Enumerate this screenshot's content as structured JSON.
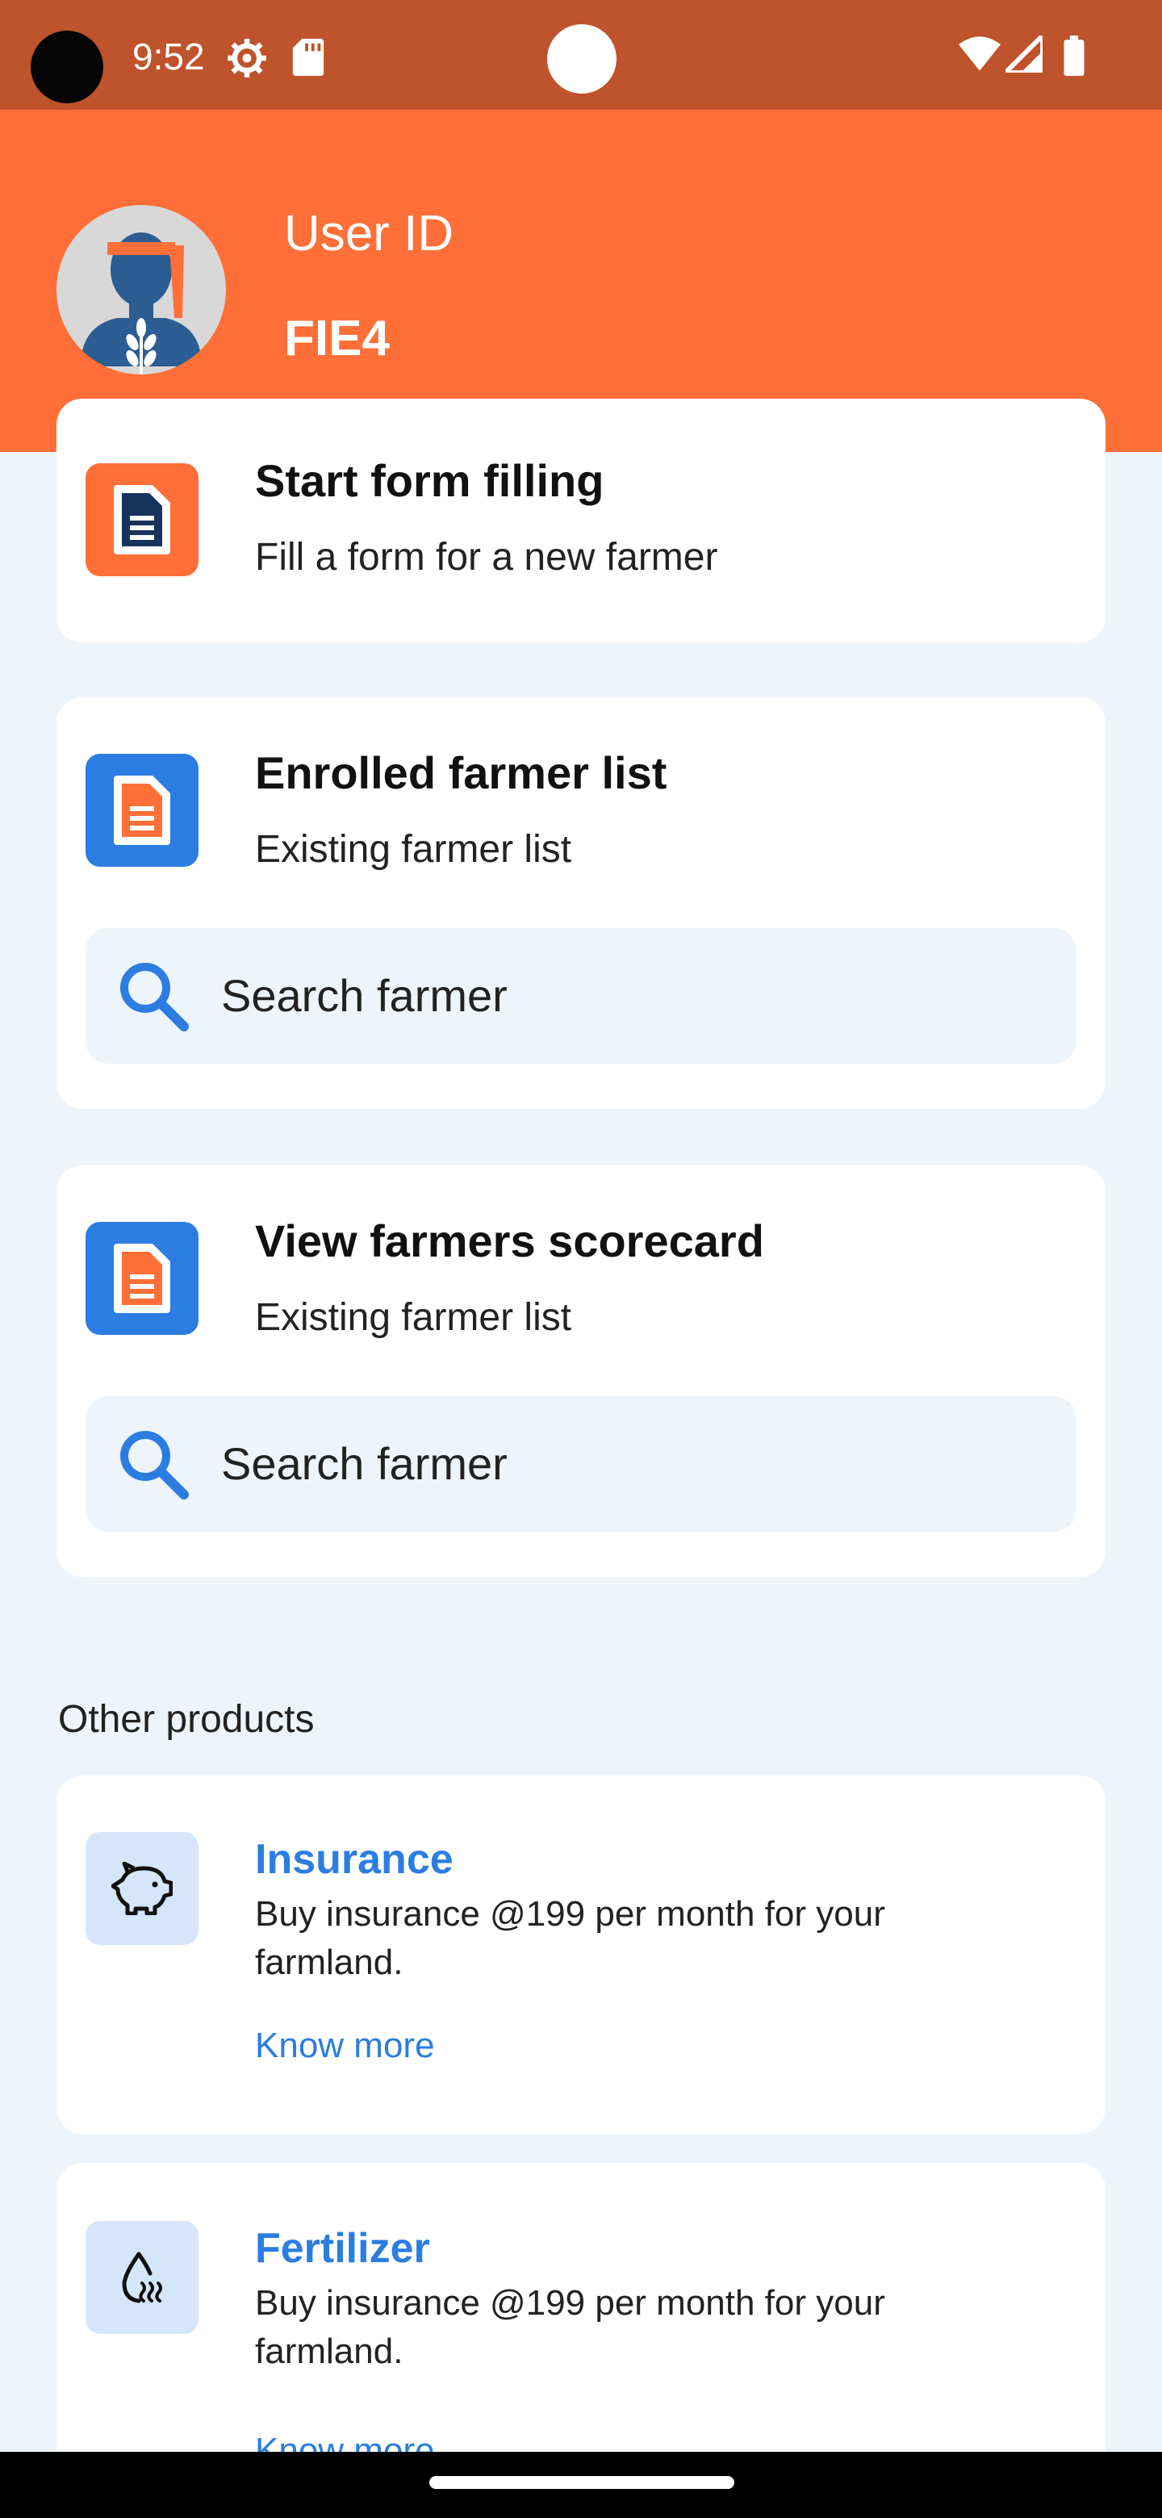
{
  "status_bar": {
    "time": "9:52",
    "icons": [
      "camera-cutout",
      "gear-icon",
      "sd-card-icon",
      "notification-dot",
      "wifi-icon",
      "cell-signal-icon",
      "battery-icon"
    ],
    "background": "#bf532b"
  },
  "header": {
    "user_id_label": "User ID",
    "user_id_value": "FIE4",
    "background": "#ff6f37",
    "avatar_icon": "farmer-avatar-icon"
  },
  "cards": {
    "start_form": {
      "title": "Start form filling",
      "subtitle": "Fill a form for a new farmer",
      "icon": "document-icon"
    },
    "enrolled_list": {
      "title": "Enrolled farmer list",
      "subtitle": "Existing farmer list",
      "icon": "document-icon",
      "search_placeholder": "Search farmer"
    },
    "scorecard": {
      "title": "View farmers scorecard",
      "subtitle": "Existing farmer list",
      "icon": "document-icon",
      "search_placeholder": "Search farmer"
    }
  },
  "other_products": {
    "label": "Other products",
    "items": [
      {
        "title": "Insurance",
        "description": "Buy insurance @199 per month for your farmland.",
        "link": "Know more",
        "icon": "piggy-bank-icon"
      },
      {
        "title": "Fertilizer",
        "description": "Buy insurance @199 per month for your farmland.",
        "link": "Know more",
        "icon": "fertilizer-drop-icon"
      }
    ]
  },
  "colors": {
    "accent_orange": "#ff6f37",
    "accent_blue": "#2b7de1",
    "page_background": "#eef4fc"
  }
}
